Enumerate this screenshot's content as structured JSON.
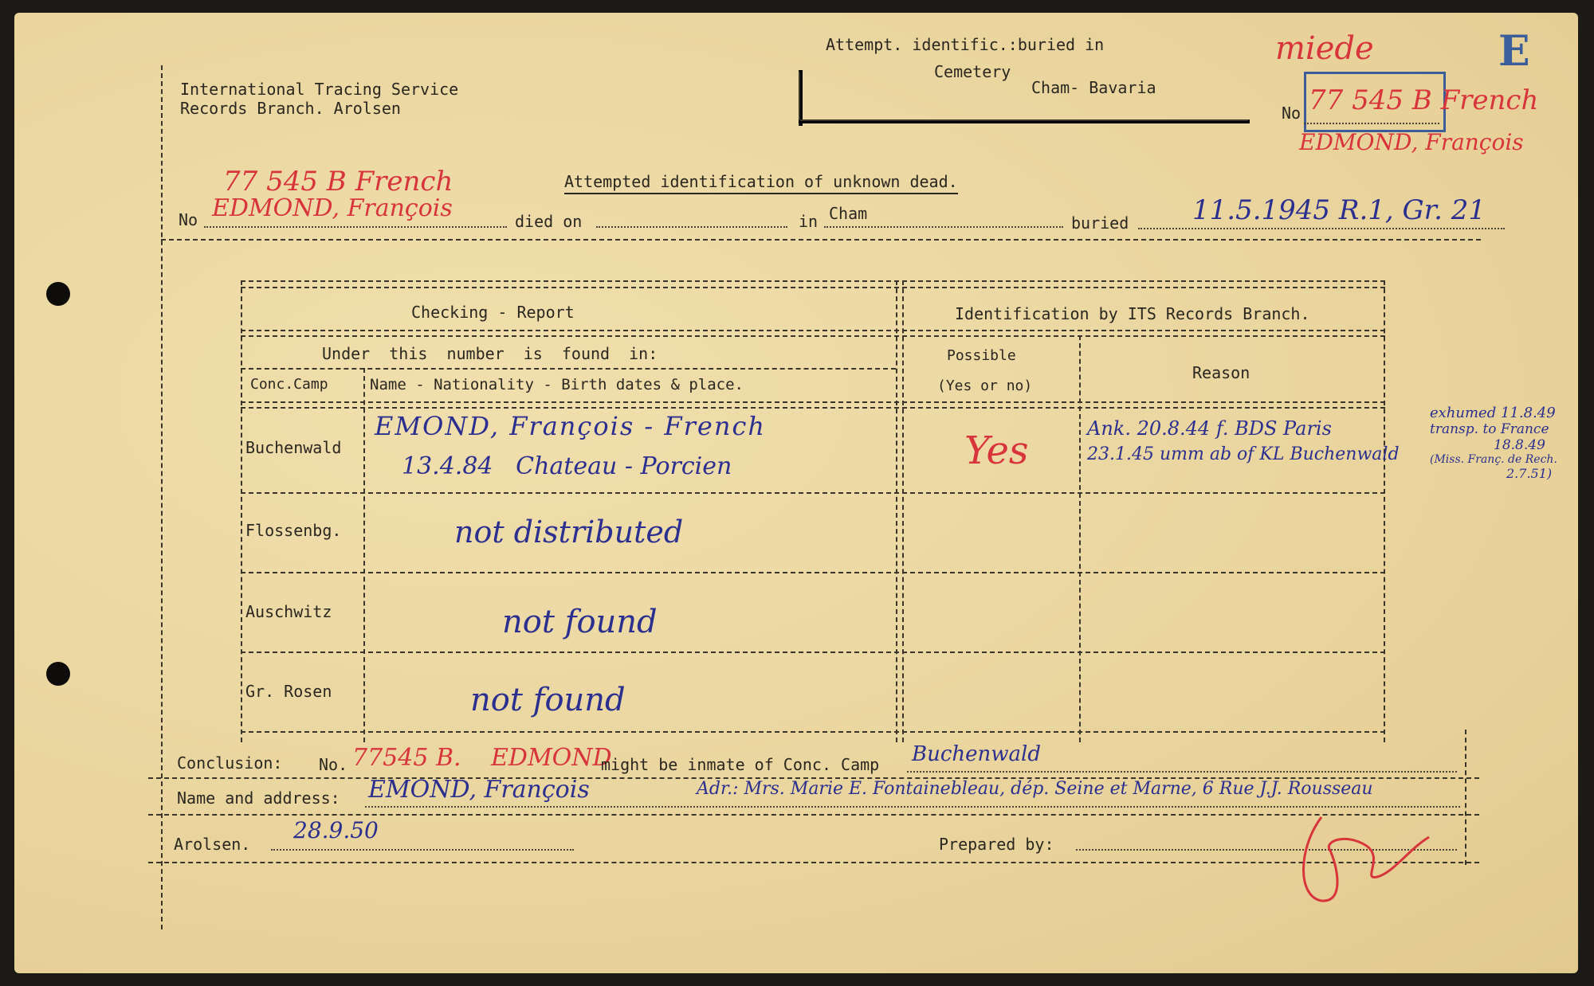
{
  "header": {
    "org_line1": "International Tracing Service",
    "org_line2": "Records Branch. Arolsen",
    "attempt_line1": "Attempt. identific.:buried in",
    "attempt_cemetery": "Cemetery",
    "attempt_place": "Cham- Bavaria",
    "no_label": "No",
    "no_value": "77 545 B French",
    "name_value": "EDMOND, François",
    "top_annotation": "miede",
    "corner_letter": "E"
  },
  "title": "Attempted identification of unknown dead.",
  "record": {
    "no_label": "No",
    "no_value": "77 545 B French",
    "name_value": "EDMOND, François",
    "died_label": "died on",
    "in_label": "in",
    "in_value": "Cham",
    "buried_label": "buried",
    "buried_value": "11.5.1945 R.1, Gr. 21"
  },
  "table": {
    "left_header": "Checking - Report",
    "right_header": "Identification by ITS Records Branch.",
    "sub_header": "Under this number is found in:",
    "col_camp": "Conc.Camp",
    "col_details": "Name - Nationality - Birth dates & place.",
    "col_possible_1": "Possible",
    "col_possible_2": "(Yes or no)",
    "col_reason": "Reason",
    "rows": [
      {
        "camp": "Buchenwald",
        "details_1": "EMOND, François - French",
        "details_2": "13.4.84   Chateau - Porcien",
        "possible": "Yes",
        "reason_1": "Ank. 20.8.44 f. BDS Paris",
        "reason_2": "23.1.45 umm ab of KL Buchenwald"
      },
      {
        "camp": "Flossenbg.",
        "details_1": "not distributed",
        "details_2": "",
        "possible": "",
        "reason_1": "",
        "reason_2": ""
      },
      {
        "camp": "Auschwitz",
        "details_1": "not found",
        "details_2": "",
        "possible": "",
        "reason_1": "",
        "reason_2": ""
      },
      {
        "camp": "Gr. Rosen",
        "details_1": "not found",
        "details_2": "",
        "possible": "",
        "reason_1": "",
        "reason_2": ""
      }
    ],
    "margin_note": [
      "exhumed 11.8.49",
      "transp. to France",
      "18.8.49",
      "(Miss. Franç. de Rech.",
      "2.7.51)"
    ]
  },
  "conclusion": {
    "label": "Conclusion:",
    "no_label": "No.",
    "no_value": "77545 B.",
    "name_value": "EDMOND",
    "text": "might be inmate of Conc. Camp",
    "camp_value": "Buchenwald"
  },
  "address": {
    "label": "Name and address:",
    "name_value": "EMOND, François",
    "address_value": "Adr.: Mrs. Marie E. Fontainebleau, dép. Seine et Marne, 6 Rue J.J. Rousseau"
  },
  "footer": {
    "place_label": "Arolsen.",
    "date_value": "28.9.50",
    "prepared_label": "Prepared by:"
  },
  "colors": {
    "paper": "#ecd8a2",
    "ink_blue": "#2b2f8f",
    "ink_red": "#d8343c",
    "type": "#2a2620"
  }
}
